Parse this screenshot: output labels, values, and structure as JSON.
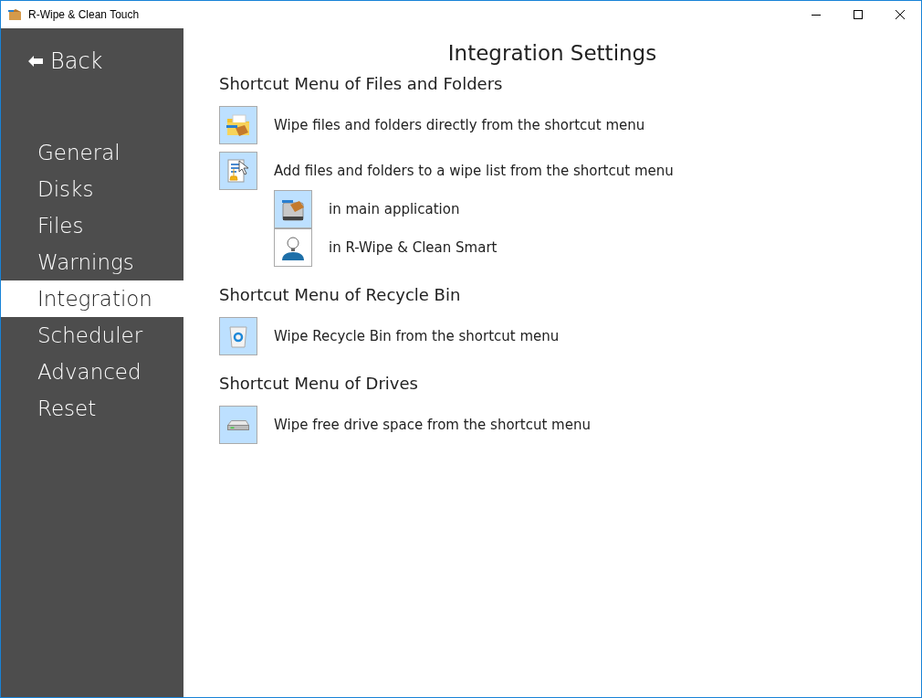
{
  "window": {
    "title": "R-Wipe & Clean Touch"
  },
  "sidebar": {
    "back": "Back",
    "items": [
      {
        "label": "General",
        "selected": false
      },
      {
        "label": "Disks",
        "selected": false
      },
      {
        "label": "Files",
        "selected": false
      },
      {
        "label": "Warnings",
        "selected": false
      },
      {
        "label": "Integration",
        "selected": true
      },
      {
        "label": "Scheduler",
        "selected": false
      },
      {
        "label": "Advanced",
        "selected": false
      },
      {
        "label": "Reset",
        "selected": false
      }
    ]
  },
  "page": {
    "title": "Integration Settings",
    "sections": [
      {
        "heading": "Shortcut Menu of Files and Folders",
        "options": [
          {
            "kind": "folder",
            "label": "Wipe files and folders directly from the shortcut menu",
            "checked": true
          },
          {
            "kind": "list",
            "label": "Add files and folders to a wipe list from the shortcut menu",
            "checked": true,
            "children": [
              {
                "kind": "app",
                "label": "in main application",
                "checked": true
              },
              {
                "kind": "smart",
                "label": "in R-Wipe & Clean Smart",
                "checked": false
              }
            ]
          }
        ]
      },
      {
        "heading": "Shortcut Menu of Recycle Bin",
        "options": [
          {
            "kind": "bin",
            "label": "Wipe Recycle Bin from the shortcut menu",
            "checked": true
          }
        ]
      },
      {
        "heading": "Shortcut Menu of Drives",
        "options": [
          {
            "kind": "drive",
            "label": "Wipe free drive space from the shortcut menu",
            "checked": true
          }
        ]
      }
    ]
  }
}
